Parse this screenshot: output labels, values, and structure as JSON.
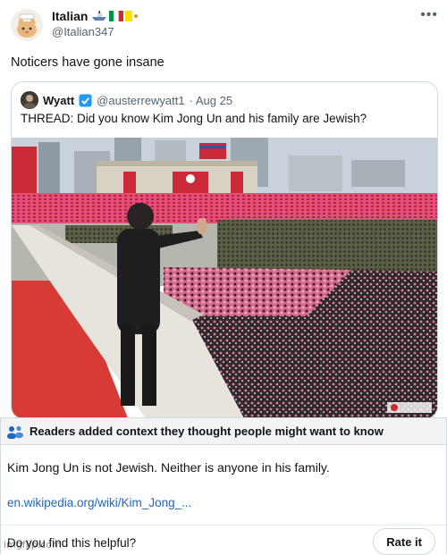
{
  "tweet": {
    "name": "Italian",
    "handle": "@Italian347",
    "text": "Noticers have gone insane",
    "more_icon": "more-dots-icon"
  },
  "quoted": {
    "name": "Wyatt",
    "handle": "@austerrewyatt1",
    "date": "· Aug 25",
    "text": "THREAD: Did you know Kim Jong Un and his family are Jewish?",
    "verified_icon": "verified-badge-icon"
  },
  "note": {
    "header": "Readers added context they thought people might want to know",
    "body": "Kim Jong Un is not Jewish. Neither is anyone in his family.",
    "link": "en.wikipedia.org/wiki/Kim_Jong_...",
    "helpful_question": "Do you find this helpful?",
    "rate_label": "Rate it",
    "icon": "readers-people-icon"
  },
  "watermark": "imgflip.com",
  "colors": {
    "link_blue": "#1d66c2",
    "verified_blue": "#1d9bf0",
    "note_header_bg": "#f1f3f5",
    "flag_red": "#d8202a",
    "flag_pink": "#e86a8a"
  }
}
